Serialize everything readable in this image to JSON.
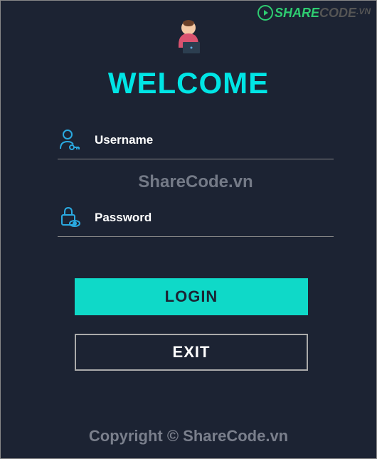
{
  "branding": {
    "share": "SHARE",
    "code": "CODE",
    "vn": ".VN"
  },
  "header": {
    "welcome": "WELCOME"
  },
  "form": {
    "username_placeholder": "Username",
    "username_value": "",
    "password_placeholder": "Password",
    "password_value": "",
    "watermark": "ShareCode.vn"
  },
  "buttons": {
    "login": "LOGIN",
    "exit": "EXIT"
  },
  "footer": {
    "copyright": "Copyright © ShareCode.vn"
  }
}
